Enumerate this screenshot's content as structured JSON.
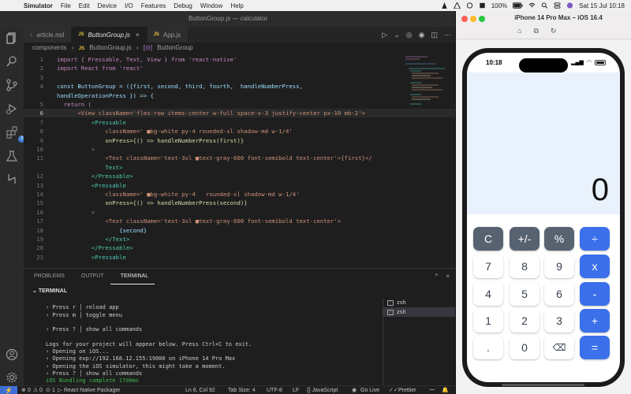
{
  "menubar": {
    "app": "Simulator",
    "items": [
      "File",
      "Edit",
      "Device",
      "I/O",
      "Features",
      "Debug",
      "Window",
      "Help"
    ],
    "battery": "100%",
    "datetime": "Sat 15 Jul  10:18"
  },
  "vscode": {
    "window_title": "ButtonGroup.js — calculator",
    "tabs": [
      {
        "label": "article.md",
        "icon": "markdown-icon"
      },
      {
        "label": "ButtonGroup.js",
        "icon": "js-icon",
        "active": true
      },
      {
        "label": "App.js",
        "icon": "js-icon"
      }
    ],
    "breadcrumb": [
      "components",
      "ButtonGroup.js",
      "ButtonGroup"
    ],
    "activity_badge": "3",
    "code_lines": [
      {
        "n": "1",
        "text": "import { Pressable, Text, View } from 'react-native'"
      },
      {
        "n": "2",
        "text": "import React from 'react'"
      },
      {
        "n": "3",
        "text": ""
      },
      {
        "n": "4",
        "text": "const ButtonGroup = ({first, second, third, fourth,  handleNumberPress,"
      },
      {
        "n": "",
        "text": "handleOperationPress }) => {"
      },
      {
        "n": "5",
        "text": "  return ("
      },
      {
        "n": "6",
        "text": "      <View className='flex-row items-center w-full space-x-3 justify-center px-10 mb-2'>"
      },
      {
        "n": "7",
        "text": "          <Pressable"
      },
      {
        "n": "8",
        "text": "              className=' ■bg-white py-4 rounded-xl shadow-md w-1/4'"
      },
      {
        "n": "9",
        "text": "              onPress={() => handleNumberPress(first)}"
      },
      {
        "n": "10",
        "text": "          >"
      },
      {
        "n": "11",
        "text": "              <Text className='text-3xl ■text-gray-600 font-semibold text-center'>{first}</"
      },
      {
        "n": "",
        "text": "              Text>"
      },
      {
        "n": "12",
        "text": "          </Pressable>"
      },
      {
        "n": "13",
        "text": "          <Pressable"
      },
      {
        "n": "14",
        "text": "              className=' ■bg-white py-4   rounded-xl shadow-md w-1/4'"
      },
      {
        "n": "15",
        "text": "              onPress={() => handleNumberPress(second)}"
      },
      {
        "n": "16",
        "text": "          >"
      },
      {
        "n": "17",
        "text": "              <Text className='text-3xl ■text-gray-600 font-semibold text-center'>"
      },
      {
        "n": "18",
        "text": "                  {second}"
      },
      {
        "n": "19",
        "text": "              </Text>"
      },
      {
        "n": "20",
        "text": "          </Pressable>"
      },
      {
        "n": "21",
        "text": "          <Pressable"
      }
    ],
    "panel": {
      "tabs": [
        "PROBLEMS",
        "OUTPUT",
        "TERMINAL"
      ],
      "active_tab": "TERMINAL",
      "terminal_title": "TERMINAL",
      "terminal_lines": [
        "",
        "› Press r │ reload app",
        "› Press m │ toggle menu",
        "",
        "› Press ? │ show all commands",
        "",
        "Logs for your project will appear below. Press Ctrl+C to exit.",
        "› Opening on iOS...",
        "› Opening exp://192.168.12.155:19000 on iPhone 14 Pro Max",
        "› Opening the iOS simulator, this might take a moment.",
        "› Press ? │ show all commands",
        "iOS Bundling complete 1700ms"
      ],
      "terminals": [
        "zsh",
        "zsh"
      ]
    },
    "status": {
      "errors": "0",
      "warnings": "0",
      "ports": "1",
      "packager": "React Native Packager",
      "position": "Ln 6, Col 92",
      "tab_size": "Tab Size: 4",
      "encoding": "UTF-8",
      "eol": "LF",
      "language": "{} JavaScript",
      "golive": "Go Live",
      "prettier": "Prettier"
    }
  },
  "simulator": {
    "title": "iPhone 14 Pro Max – iOS 16.4",
    "time": "10:18",
    "display": "0",
    "keys": [
      [
        "C",
        "+/-",
        "%",
        "÷"
      ],
      [
        "7",
        "8",
        "9",
        "x"
      ],
      [
        "4",
        "5",
        "6",
        "-"
      ],
      [
        "1",
        "2",
        "3",
        "+"
      ],
      [
        ".",
        "0",
        "⌫",
        "="
      ]
    ]
  },
  "colors": {
    "operator_blue": "#3b70ea",
    "function_gray": "#566270",
    "display_bg": "#e9f1fc",
    "statusbar_remote": "#3f6fd6"
  }
}
